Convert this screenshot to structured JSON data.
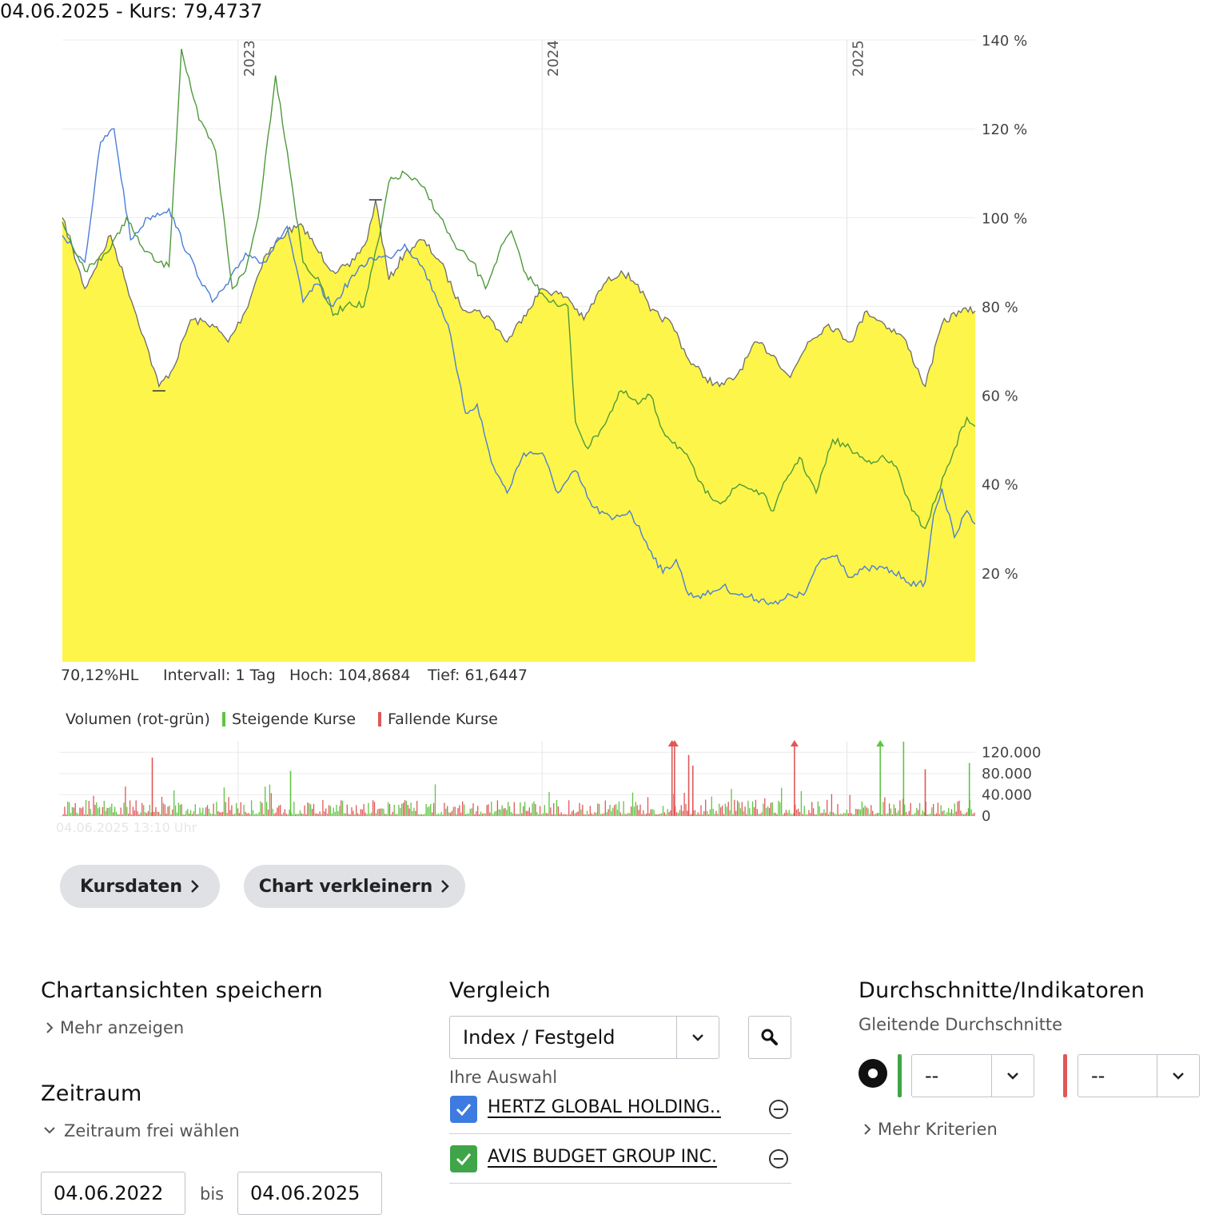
{
  "header": {
    "date_price": "04.06.2025  - Kurs: 79,4737"
  },
  "chart_data": {
    "type": "line",
    "x_range": [
      "2022-06-04",
      "2025-06-04"
    ],
    "year_labels": [
      {
        "label": "2023",
        "date": "2023-01-01"
      },
      {
        "label": "2024",
        "date": "2024-01-01"
      },
      {
        "label": "2025",
        "date": "2025-01-01"
      }
    ],
    "ylim": [
      0,
      140
    ],
    "y_ticks": [
      {
        "value": 20,
        "label": "20 %"
      },
      {
        "value": 40,
        "label": "40 %"
      },
      {
        "value": 60,
        "label": "60 %"
      },
      {
        "value": 80,
        "label": "80 %"
      },
      {
        "value": 100,
        "label": "100 %"
      },
      {
        "value": 120,
        "label": "120 %"
      },
      {
        "value": 140,
        "label": "140 %"
      }
    ],
    "grid": true,
    "colors": {
      "main_fill": "#fdf54a",
      "main_line": "#6b6b6b",
      "blue": "#4a7fd6",
      "green": "#4e9a3a"
    },
    "series": [
      {
        "kind": "area",
        "points": [
          [
            "2022-06-04",
            100
          ],
          [
            "2022-07-01",
            84
          ],
          [
            "2022-08-01",
            96
          ],
          [
            "2022-08-20",
            85
          ],
          [
            "2022-09-10",
            73
          ],
          [
            "2022-09-28",
            62
          ],
          [
            "2022-10-15",
            66
          ],
          [
            "2022-11-05",
            77
          ],
          [
            "2022-12-01",
            76
          ],
          [
            "2022-12-20",
            72
          ],
          [
            "2023-01-10",
            79
          ],
          [
            "2023-02-01",
            91
          ],
          [
            "2023-03-01",
            97
          ],
          [
            "2023-03-20",
            98
          ],
          [
            "2023-04-05",
            93
          ],
          [
            "2023-04-25",
            88
          ],
          [
            "2023-05-15",
            89
          ],
          [
            "2023-06-05",
            95
          ],
          [
            "2023-06-15",
            104
          ],
          [
            "2023-07-01",
            86
          ],
          [
            "2023-07-20",
            92
          ],
          [
            "2023-08-10",
            95
          ],
          [
            "2023-09-01",
            90
          ],
          [
            "2023-09-25",
            80
          ],
          [
            "2023-10-15",
            79
          ],
          [
            "2023-11-01",
            77
          ],
          [
            "2023-11-20",
            72
          ],
          [
            "2023-12-10",
            78
          ],
          [
            "2024-01-01",
            84
          ],
          [
            "2024-02-01",
            82
          ],
          [
            "2024-02-20",
            77
          ],
          [
            "2024-03-15",
            85
          ],
          [
            "2024-04-05",
            88
          ],
          [
            "2024-04-25",
            85
          ],
          [
            "2024-05-10",
            79
          ],
          [
            "2024-06-05",
            76
          ],
          [
            "2024-06-25",
            68
          ],
          [
            "2024-07-15",
            64
          ],
          [
            "2024-08-01",
            62
          ],
          [
            "2024-08-20",
            64
          ],
          [
            "2024-09-15",
            72
          ],
          [
            "2024-10-05",
            69
          ],
          [
            "2024-10-25",
            64
          ],
          [
            "2024-11-15",
            72
          ],
          [
            "2024-12-10",
            76
          ],
          [
            "2025-01-05",
            72
          ],
          [
            "2025-01-25",
            79
          ],
          [
            "2025-02-15",
            76
          ],
          [
            "2025-03-10",
            73
          ],
          [
            "2025-04-05",
            62
          ],
          [
            "2025-04-25",
            76
          ],
          [
            "2025-05-15",
            79
          ],
          [
            "2025-06-04",
            79
          ]
        ]
      },
      {
        "kind": "line",
        "color": "blue",
        "points": [
          [
            "2022-06-04",
            96
          ],
          [
            "2022-07-01",
            90
          ],
          [
            "2022-07-20",
            117
          ],
          [
            "2022-08-05",
            120
          ],
          [
            "2022-08-25",
            95
          ],
          [
            "2022-09-15",
            100
          ],
          [
            "2022-10-10",
            102
          ],
          [
            "2022-11-01",
            92
          ],
          [
            "2022-12-01",
            81
          ],
          [
            "2022-12-20",
            85
          ],
          [
            "2023-01-10",
            92
          ],
          [
            "2023-02-01",
            90
          ],
          [
            "2023-03-01",
            98
          ],
          [
            "2023-03-20",
            81
          ],
          [
            "2023-04-05",
            85
          ],
          [
            "2023-04-25",
            80
          ],
          [
            "2023-05-15",
            86
          ],
          [
            "2023-06-10",
            91
          ],
          [
            "2023-07-01",
            91
          ],
          [
            "2023-07-20",
            94
          ],
          [
            "2023-08-10",
            89
          ],
          [
            "2023-08-25",
            83
          ],
          [
            "2023-09-10",
            76
          ],
          [
            "2023-09-20",
            66
          ],
          [
            "2023-10-01",
            56
          ],
          [
            "2023-10-15",
            58
          ],
          [
            "2023-11-01",
            45
          ],
          [
            "2023-11-20",
            38
          ],
          [
            "2023-12-10",
            47
          ],
          [
            "2024-01-01",
            47
          ],
          [
            "2024-01-20",
            38
          ],
          [
            "2024-02-10",
            43
          ],
          [
            "2024-03-01",
            35
          ],
          [
            "2024-03-25",
            32
          ],
          [
            "2024-04-15",
            34
          ],
          [
            "2024-05-05",
            27
          ],
          [
            "2024-05-25",
            20
          ],
          [
            "2024-06-10",
            23
          ],
          [
            "2024-06-25",
            15
          ],
          [
            "2024-07-15",
            15
          ],
          [
            "2024-08-05",
            17
          ],
          [
            "2024-08-25",
            15
          ],
          [
            "2024-09-20",
            14
          ],
          [
            "2024-10-10",
            13
          ],
          [
            "2024-10-25",
            15
          ],
          [
            "2024-11-10",
            15
          ],
          [
            "2024-12-01",
            23
          ],
          [
            "2024-12-20",
            24
          ],
          [
            "2025-01-05",
            19
          ],
          [
            "2025-01-25",
            21
          ],
          [
            "2025-02-15",
            21
          ],
          [
            "2025-03-10",
            19
          ],
          [
            "2025-03-25",
            17
          ],
          [
            "2025-04-05",
            18
          ],
          [
            "2025-04-15",
            33
          ],
          [
            "2025-04-25",
            39
          ],
          [
            "2025-05-10",
            28
          ],
          [
            "2025-05-25",
            34
          ],
          [
            "2025-06-04",
            31
          ]
        ]
      },
      {
        "kind": "line",
        "color": "green",
        "points": [
          [
            "2022-06-04",
            99
          ],
          [
            "2022-07-01",
            88
          ],
          [
            "2022-08-01",
            93
          ],
          [
            "2022-08-20",
            100
          ],
          [
            "2022-09-05",
            94
          ],
          [
            "2022-09-25",
            90
          ],
          [
            "2022-10-10",
            89
          ],
          [
            "2022-10-25",
            138
          ],
          [
            "2022-11-15",
            122
          ],
          [
            "2022-12-05",
            115
          ],
          [
            "2022-12-25",
            84
          ],
          [
            "2023-01-10",
            88
          ],
          [
            "2023-01-25",
            100
          ],
          [
            "2023-02-15",
            132
          ],
          [
            "2023-03-01",
            115
          ],
          [
            "2023-03-20",
            90
          ],
          [
            "2023-04-10",
            85
          ],
          [
            "2023-04-25",
            78
          ],
          [
            "2023-05-15",
            81
          ],
          [
            "2023-06-01",
            80
          ],
          [
            "2023-06-20",
            96
          ],
          [
            "2023-07-01",
            108
          ],
          [
            "2023-07-20",
            110
          ],
          [
            "2023-08-10",
            107
          ],
          [
            "2023-09-01",
            100
          ],
          [
            "2023-09-20",
            93
          ],
          [
            "2023-10-10",
            90
          ],
          [
            "2023-10-25",
            84
          ],
          [
            "2023-11-10",
            92
          ],
          [
            "2023-11-25",
            97
          ],
          [
            "2023-12-10",
            88
          ],
          [
            "2024-01-01",
            83
          ],
          [
            "2024-01-20",
            80
          ],
          [
            "2024-02-01",
            80
          ],
          [
            "2024-02-10",
            54
          ],
          [
            "2024-02-25",
            48
          ],
          [
            "2024-03-20",
            55
          ],
          [
            "2024-04-05",
            61
          ],
          [
            "2024-04-25",
            58
          ],
          [
            "2024-05-10",
            60
          ],
          [
            "2024-05-25",
            52
          ],
          [
            "2024-06-20",
            47
          ],
          [
            "2024-07-15",
            38
          ],
          [
            "2024-08-05",
            36
          ],
          [
            "2024-08-25",
            40
          ],
          [
            "2024-09-20",
            38
          ],
          [
            "2024-10-05",
            34
          ],
          [
            "2024-10-20",
            41
          ],
          [
            "2024-11-05",
            46
          ],
          [
            "2024-11-25",
            38
          ],
          [
            "2024-12-15",
            50
          ],
          [
            "2025-01-05",
            48
          ],
          [
            "2025-01-25",
            45
          ],
          [
            "2025-02-10",
            46
          ],
          [
            "2025-03-01",
            44
          ],
          [
            "2025-03-20",
            34
          ],
          [
            "2025-04-05",
            30
          ],
          [
            "2025-04-20",
            38
          ],
          [
            "2025-05-10",
            48
          ],
          [
            "2025-05-25",
            55
          ],
          [
            "2025-06-04",
            53
          ]
        ]
      }
    ],
    "markers": [
      {
        "label": "Hoch",
        "date": "2023-06-15",
        "value": 104
      },
      {
        "label": "Tief",
        "date": "2022-09-28",
        "value": 61
      }
    ],
    "stats": {
      "hl": "70,12%HL",
      "interval": "Intervall: 1 Tag",
      "high": "Hoch: 104,8684",
      "low": "Tief: 61,6447"
    },
    "volume": {
      "legend_title": "Volumen (rot-grün)",
      "rising_label": "Steigende Kurse",
      "falling_label": "Fallende Kurse",
      "rising_color": "#5fc442",
      "falling_color": "#e05757",
      "ylim": [
        0,
        140000
      ],
      "y_ticks": [
        {
          "value": 120000,
          "label": "120.000"
        },
        {
          "value": 80000,
          "label": "80.000"
        },
        {
          "value": 40000,
          "label": "40.000"
        },
        {
          "value": 0,
          "label": "0"
        }
      ],
      "spikes": [
        {
          "date": "2022-09-20",
          "value": 110000,
          "dir": "falling"
        },
        {
          "date": "2023-03-05",
          "value": 85000,
          "dir": "rising"
        },
        {
          "date": "2024-06-05",
          "value": 150000,
          "dir": "falling",
          "clipped": true
        },
        {
          "date": "2024-06-08",
          "value": 145000,
          "dir": "falling",
          "clipped": true
        },
        {
          "date": "2024-06-25",
          "value": 115000,
          "dir": "falling"
        },
        {
          "date": "2024-06-30",
          "value": 95000,
          "dir": "falling"
        },
        {
          "date": "2024-10-30",
          "value": 150000,
          "dir": "falling",
          "clipped": true
        },
        {
          "date": "2025-02-10",
          "value": 150000,
          "dir": "rising",
          "clipped": true
        },
        {
          "date": "2025-03-10",
          "value": 150000,
          "dir": "rising"
        },
        {
          "date": "2025-04-05",
          "value": 88000,
          "dir": "falling"
        },
        {
          "date": "2025-05-28",
          "value": 100000,
          "dir": "rising"
        }
      ]
    },
    "watermark": "04.06.2025 13:10 Uhr"
  },
  "buttons": {
    "kursdaten": "Kursdaten",
    "chart_verkleinern": "Chart verkleinern"
  },
  "chartansichten": {
    "title": "Chartansichten speichern",
    "more": "Mehr anzeigen"
  },
  "zeitraum": {
    "title": "Zeitraum",
    "toggle": "Zeitraum frei wählen",
    "from": "04.06.2022",
    "separator": "bis",
    "to": "04.06.2025"
  },
  "vergleich": {
    "title": "Vergleich",
    "select_value": "Index / Festgeld",
    "selection_label": "Ihre Auswahl",
    "items": [
      {
        "label": "HERTZ GLOBAL HOLDING..",
        "checkbox_color": "#3d7be0"
      },
      {
        "label": "AVIS BUDGET GROUP INC.",
        "checkbox_color": "#3fa548"
      }
    ]
  },
  "indikatoren": {
    "title": "Durchschnitte/Indikatoren",
    "subtitle": "Gleitende Durchschnitte",
    "select1_value": "--",
    "select2_value": "--",
    "select1_color": "#3fa548",
    "select2_color": "#e05757",
    "more": "Mehr Kriterien"
  }
}
